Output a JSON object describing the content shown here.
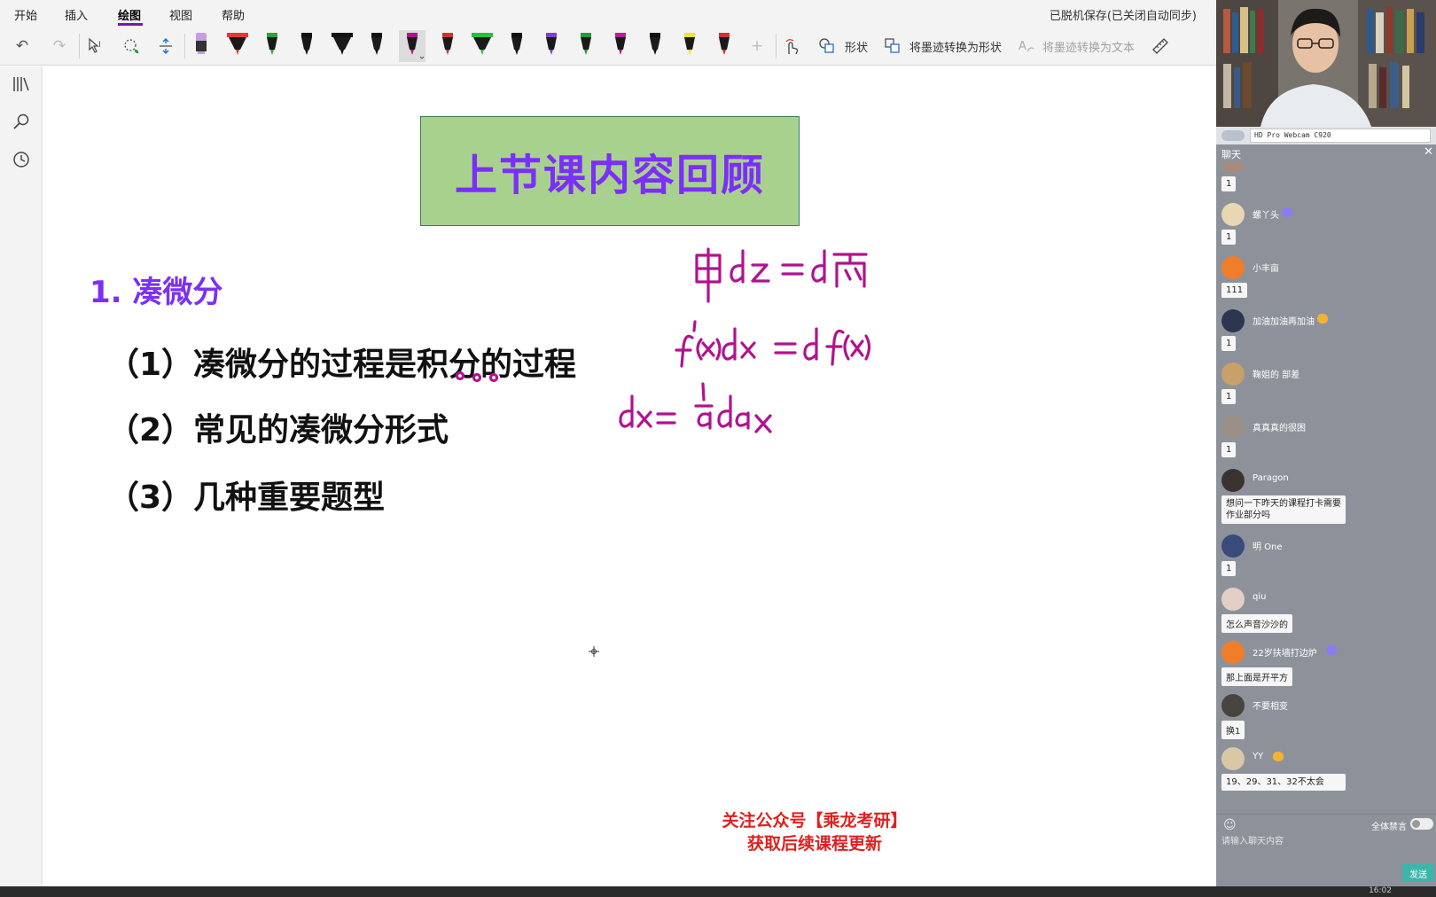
{
  "menu": {
    "tabs": [
      "开始",
      "插入",
      "绘图",
      "视图",
      "帮助"
    ],
    "active_tab": "绘图",
    "sync_status": "已脱机保存(已关闭自动同步)"
  },
  "toolbar": {
    "shape_label": "形状",
    "ink_to_shape_label": "将墨迹转换为形状",
    "ink_to_text_label": "将墨迹转换为文本",
    "pens": [
      {
        "name": "highlighter-purple",
        "color": "#c59de0"
      },
      {
        "name": "pen-red-wide",
        "color": "#e53935"
      },
      {
        "name": "pen-green",
        "color": "#23a63a"
      },
      {
        "name": "pen-black",
        "color": "#111111"
      },
      {
        "name": "pen-black-wide",
        "color": "#111111"
      },
      {
        "name": "pen-black-fine",
        "color": "#111111"
      },
      {
        "name": "pen-purple-selected",
        "color": "#b0138f"
      },
      {
        "name": "pen-red",
        "color": "#d32f2f"
      },
      {
        "name": "pen-green-wide",
        "color": "#23c43a"
      },
      {
        "name": "pen-black-2",
        "color": "#111111"
      },
      {
        "name": "pen-violet",
        "color": "#7e3fd6"
      },
      {
        "name": "pen-green-2",
        "color": "#1f9e3a"
      },
      {
        "name": "pen-magenta",
        "color": "#c2189b"
      },
      {
        "name": "pen-black-3",
        "color": "#111111"
      },
      {
        "name": "pen-yellow",
        "color": "#f2e22c"
      },
      {
        "name": "pen-red-2",
        "color": "#d32f2f"
      }
    ]
  },
  "page": {
    "title": "上节课内容回顾",
    "section_heading": "1. 凑微分",
    "points": [
      "（1）凑微分的过程是积分的过程",
      "（2）常见的凑微分形式",
      "（3）几种重要题型"
    ],
    "footer_note": [
      "关注公众号【乘龙考研】",
      "获取后续课程更新"
    ],
    "ink_color": "#b0138f",
    "title_bg": "#a9d18e",
    "title_color": "#7b2ff7"
  },
  "stream": {
    "camera_name": "HD Pro Webcam C920",
    "chat_title": "聊天",
    "messages": [
      {
        "user": "",
        "text": "1",
        "avatar": "#a8897a",
        "badge": ""
      },
      {
        "user": "螺丫头",
        "text": "1",
        "avatar": "#e9d6b3",
        "badge": "#8a7cf0"
      },
      {
        "user": "小丰亩",
        "text": "111",
        "avatar": "#f07d2a",
        "badge": ""
      },
      {
        "user": "加油加油再加油",
        "text": "1",
        "avatar": "#2d3650",
        "badge": "#f2b233"
      },
      {
        "user": "鞠姐的 部差",
        "text": "1",
        "avatar": "#c9a06a",
        "badge": ""
      },
      {
        "user": "真真真的很困",
        "text": "1",
        "avatar": "#9a8f86",
        "badge": ""
      },
      {
        "user": "Paragon",
        "text": "想问一下昨天的课程打卡需要作业部分吗",
        "avatar": "#3b3330",
        "badge": ""
      },
      {
        "user": "明 One",
        "text": "1",
        "avatar": "#3a4a7a",
        "badge": ""
      },
      {
        "user": "qiu",
        "text": "怎么声音沙沙的",
        "avatar": "#e3cfc6",
        "badge": ""
      },
      {
        "user": "22岁扶墙打边炉",
        "text": "那上面是开平方",
        "avatar": "#f07d2a",
        "badge": "#8a7cf0"
      },
      {
        "user": "不要相变",
        "text": "换1",
        "avatar": "#4a4440",
        "badge": ""
      },
      {
        "user": "YY",
        "text": "19、29、31、32不太会",
        "avatar": "#d9c7a6",
        "badge": "#f2b233"
      }
    ],
    "mute_all_label": "全体禁言",
    "input_placeholder": "请输入聊天内容",
    "send_label": "发送"
  },
  "taskbar": {
    "clock": "16:02"
  }
}
